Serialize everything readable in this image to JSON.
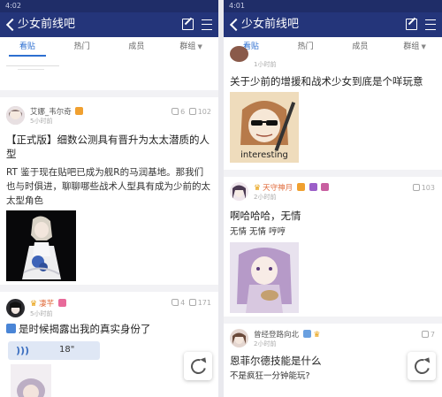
{
  "left": {
    "status_time": "4:02",
    "title": "少女前线吧",
    "tabs": [
      "看贴",
      "热门",
      "成员",
      "群组"
    ],
    "posts": [
      {
        "user": "艾娜_韦尔奇",
        "time": "5小时前",
        "likes": "6",
        "comments": "102",
        "title": "【正式版】细数公测具有晋升为太太潜质的人型",
        "body": "RT 鉴于现在贴吧已成为舰R的马润基地。那我们也与时俱进，聊聊哪些战术人型具有成为少前的太太型角色"
      },
      {
        "user": "凄芊",
        "time": "5小时前",
        "likes": "4",
        "comments": "171",
        "title": "是时候揭露出我的真实身份了",
        "voice_duration": "18\""
      }
    ]
  },
  "right": {
    "status_time": "4:01",
    "title": "少女前线吧",
    "tabs": [
      "看贴",
      "热门",
      "成员",
      "群组"
    ],
    "posts": [
      {
        "time": "1小时前",
        "title": "关于少前的增援和战术少女到底是个咩玩意",
        "image_caption": "interesting"
      },
      {
        "user": "天守神月",
        "time": "2小时前",
        "comments": "103",
        "title": "啊哈哈哈，无情",
        "body": "无情 无情 哼哼"
      },
      {
        "user": "曾经登路向北",
        "time": "2小时前",
        "comments": "7",
        "title": "恩菲尔德技能是什么",
        "body": "不是疯狂一分钟能玩?"
      }
    ]
  },
  "colors": {
    "navbar": "#24357a",
    "accent": "#2d6fd0"
  }
}
